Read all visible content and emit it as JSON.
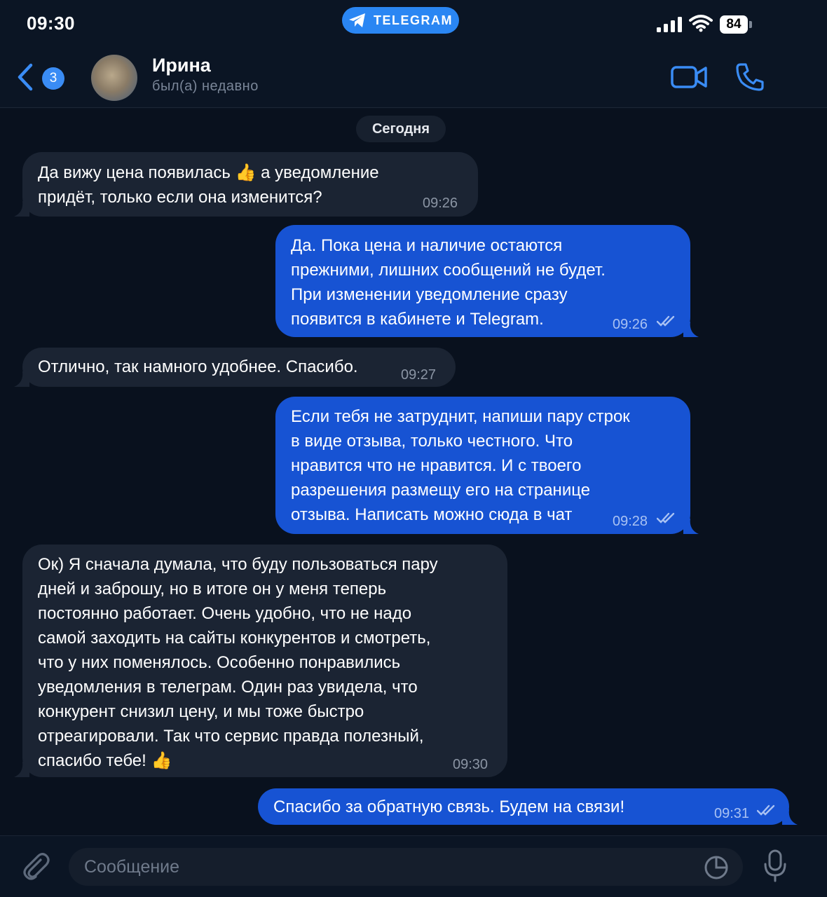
{
  "status_bar": {
    "time": "09:30",
    "pill_label": "TELEGRAM",
    "battery": "84"
  },
  "header": {
    "back_count": "3",
    "name": "Ирина",
    "status": "был(а) недавно"
  },
  "chat": {
    "date_label": "Сегодня",
    "messages": [
      {
        "dir": "in",
        "text": "Да вижу цена появилась 👍 а уведомление\nпридёт, только если она изменится?",
        "time": "09:26"
      },
      {
        "dir": "out",
        "text": "Да. Пока цена и наличие остаются\nпрежними, лишних сообщений не будет.\nПри изменении уведомление сразу\nпоявится в кабинете и Telegram.",
        "time": "09:26",
        "read": true
      },
      {
        "dir": "in",
        "text": "Отлично, так намного удобнее. Спасибо.",
        "time": "09:27"
      },
      {
        "dir": "out",
        "text": "Если тебя не затруднит, напиши пару строк\nв виде отзыва, только честного. Что\nнравится что не нравится. И с твоего\nразрешения размещу его на странице\nотзыва. Написать можно сюда в чат",
        "time": "09:28",
        "read": true
      },
      {
        "dir": "in",
        "text": "Ок) Я сначала думала, что буду пользоваться пару\nдней и заброшу, но в итоге он у меня теперь\nпостоянно работает. Очень удобно, что не надо\nсамой заходить на сайты конкурентов и смотреть,\nчто у них поменялось. Особенно понравились\nуведомления в телеграм. Один раз увидела, что\nконкурент снизил цену, и мы тоже быстро\nотреагировали. Так что сервис правда полезный,\nспасибо тебе! 👍",
        "time": "09:30"
      },
      {
        "dir": "out",
        "text": "Спасибо за обратную связь. Будем на связи!",
        "time": "09:31",
        "read": true
      }
    ]
  },
  "input": {
    "placeholder": "Сообщение"
  },
  "colors": {
    "accent": "#2a86f3",
    "outgoing_bubble": "#1753d3",
    "incoming_bubble": "#1b2433",
    "background": "#09111e"
  },
  "icons": [
    "back-chevron-icon",
    "telegram-plane-icon",
    "signal-icon",
    "wifi-icon",
    "video-camera-icon",
    "phone-icon",
    "paperclip-icon",
    "sticker-icon",
    "microphone-icon",
    "double-check-icon"
  ]
}
